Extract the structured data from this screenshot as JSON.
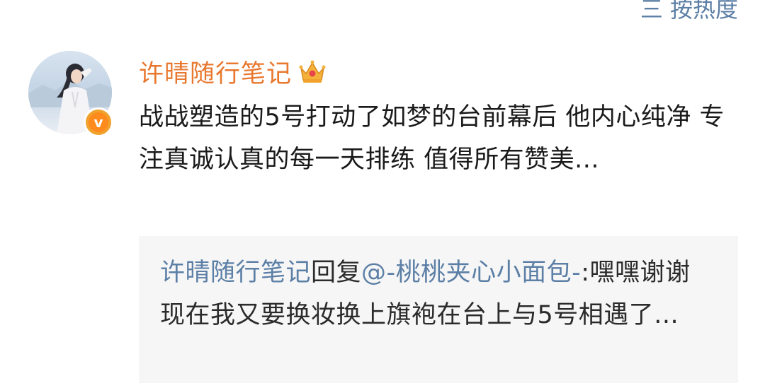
{
  "header": {
    "sort_label": "三 按热度"
  },
  "comment": {
    "username": "许晴随行笔记",
    "badge_letter": "v",
    "text": "战战塑造的5号打动了如梦的台前幕后 他内心纯净 专注真诚认真的每一天排练 值得所有赞美...",
    "reply": {
      "author": "许晴随行笔记",
      "reply_word": "回复",
      "mention": "@-桃桃夹心小面包-",
      "text": ":嘿嘿谢谢 现在我又要换妆换上旗袍在台上与5号相遇了..."
    }
  },
  "colors": {
    "username": "#e8782f",
    "link": "#5c7fa6",
    "text": "#1a1a1a",
    "reply_bg": "#f6f6f6",
    "vip_badge": "#ff8a1d"
  },
  "icons": {
    "avatar": "user-avatar",
    "verified": "vip-verified-badge",
    "crown": "crown-icon"
  }
}
